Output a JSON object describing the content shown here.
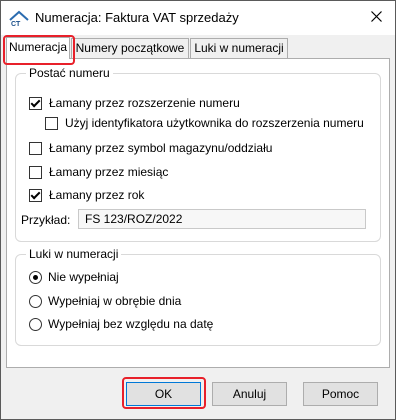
{
  "window": {
    "title": "Numeracja: Faktura VAT sprzedaży",
    "app_icon": "comarch-logo-icon",
    "close_icon": "close-icon"
  },
  "tabs": [
    {
      "label": "Numeracja",
      "active": true
    },
    {
      "label": "Numery początkowe",
      "active": false
    },
    {
      "label": "Luki w numeracji",
      "active": false
    }
  ],
  "number_format": {
    "legend": "Postać numeru",
    "options": [
      {
        "label": "Łamany przez rozszerzenie numeru",
        "checked": true
      },
      {
        "label": "Użyj identyfikatora użytkownika do rozszerzenia numeru",
        "checked": false
      },
      {
        "label": "Łamany przez symbol magazynu/oddziału",
        "checked": false
      },
      {
        "label": "Łamany przez miesiąc",
        "checked": false
      },
      {
        "label": "Łamany przez rok",
        "checked": true
      }
    ],
    "example_label": "Przykład:",
    "example_value": "FS 123/ROZ/2022"
  },
  "gaps": {
    "legend": "Luki w numeracji",
    "options": [
      {
        "label": "Nie wypełniaj",
        "selected": true
      },
      {
        "label": "Wypełniaj w obrębie dnia",
        "selected": false
      },
      {
        "label": "Wypełniaj bez względu na datę",
        "selected": false
      }
    ]
  },
  "buttons": {
    "ok": "OK",
    "cancel": "Anuluj",
    "help": "Pomoc"
  },
  "colors": {
    "highlight": "#e8202a",
    "focus_border": "#0078d7"
  }
}
